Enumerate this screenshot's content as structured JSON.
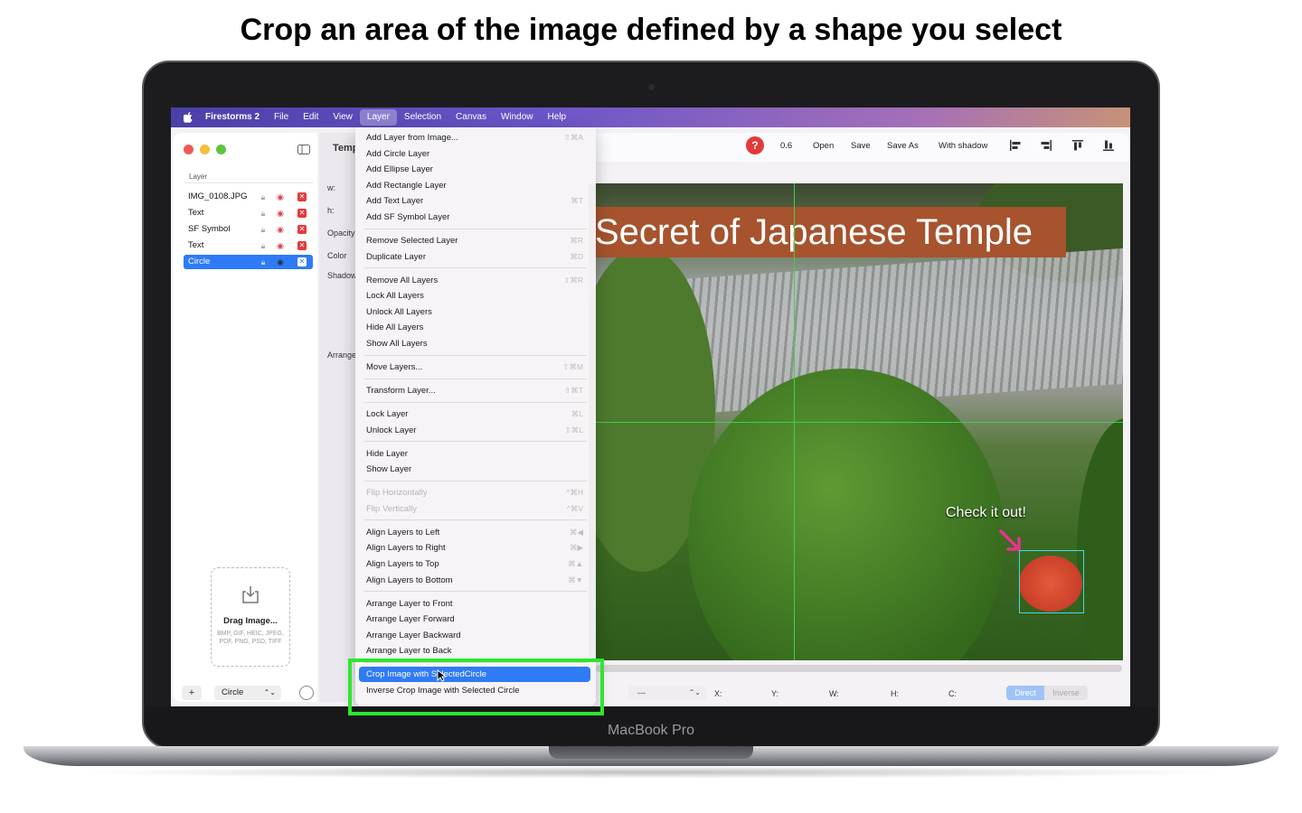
{
  "headline": "Crop an area of the image defined by a shape you select",
  "laptop": {
    "brand": "MacBook Pro"
  },
  "menubar": {
    "app": "Firestorms 2",
    "items": [
      "File",
      "Edit",
      "View",
      "Layer",
      "Selection",
      "Canvas",
      "Window",
      "Help"
    ],
    "active": "Layer"
  },
  "sidebar": {
    "section_label": "Layer",
    "layers": [
      "IMG_0108.JPG",
      "Text",
      "SF Symbol",
      "Text",
      "Circle"
    ],
    "selected_layer": "Circle",
    "dropzone": {
      "title": "Drag Image...",
      "formats": "BMP, GIF, HEIC, JPEG, PDF, PNG, PSD, TIFF"
    },
    "add_label": "+",
    "shape_select": "Circle"
  },
  "inspector": {
    "title": "Temp",
    "labels": [
      "w:",
      "h:",
      "Opacity",
      "Color",
      "Shadow",
      "Arrange"
    ]
  },
  "toolbar": {
    "help": "?",
    "zoom": "0.6",
    "open": "Open",
    "save": "Save",
    "save_as": "Save As",
    "with_shadow": "With shadow",
    "align_icons": [
      "align-left-icon",
      "align-right-icon",
      "align-top-icon",
      "align-bottom-icon"
    ]
  },
  "canvas": {
    "banner": "Secret of Japanese Temple",
    "callout": "Check it out!"
  },
  "bottom_bar": {
    "combo": "---",
    "labels": [
      "X:",
      "Y:",
      "W:",
      "H:",
      "C:"
    ],
    "segment": [
      "Direct",
      "Inverse"
    ],
    "segment_selected": "Direct"
  },
  "layer_menu": {
    "groups": [
      [
        {
          "label": "Add Layer from Image...",
          "shortcut": "⇧⌘A"
        },
        {
          "label": "Add Circle Layer",
          "shortcut": ""
        },
        {
          "label": "Add Ellipse Layer",
          "shortcut": ""
        },
        {
          "label": "Add Rectangle Layer",
          "shortcut": ""
        },
        {
          "label": "Add Text Layer",
          "shortcut": "⌘T"
        },
        {
          "label": "Add SF Symbol Layer",
          "shortcut": ""
        }
      ],
      [
        {
          "label": "Remove Selected Layer",
          "shortcut": "⌘R"
        },
        {
          "label": "Duplicate Layer",
          "shortcut": "⌘D"
        }
      ],
      [
        {
          "label": "Remove All Layers",
          "shortcut": "⇧⌘R"
        },
        {
          "label": "Lock All Layers",
          "shortcut": ""
        },
        {
          "label": "Unlock All Layers",
          "shortcut": ""
        },
        {
          "label": "Hide All Layers",
          "shortcut": ""
        },
        {
          "label": "Show All Layers",
          "shortcut": ""
        }
      ],
      [
        {
          "label": "Move Layers...",
          "shortcut": "⇧⌘M"
        }
      ],
      [
        {
          "label": "Transform Layer...",
          "shortcut": "⇧⌘T"
        }
      ],
      [
        {
          "label": "Lock Layer",
          "shortcut": "⌘L"
        },
        {
          "label": "Unlock Layer",
          "shortcut": "⇧⌘L"
        }
      ],
      [
        {
          "label": "Hide Layer",
          "shortcut": ""
        },
        {
          "label": "Show Layer",
          "shortcut": ""
        }
      ],
      [
        {
          "label": "Flip Horizontally",
          "shortcut": "^⌘H",
          "disabled": true
        },
        {
          "label": "Flip Vertically",
          "shortcut": "^⌘V",
          "disabled": true
        }
      ],
      [
        {
          "label": "Align Layers to Left",
          "shortcut": "⌘◀"
        },
        {
          "label": "Align Layers to Right",
          "shortcut": "⌘▶"
        },
        {
          "label": "Align Layers to Top",
          "shortcut": "⌘▲"
        },
        {
          "label": "Align Layers to Bottom",
          "shortcut": "⌘▼"
        }
      ],
      [
        {
          "label": "Arrange Layer to Front",
          "shortcut": ""
        },
        {
          "label": "Arrange Layer Forward",
          "shortcut": ""
        },
        {
          "label": "Arrange Layer Backward",
          "shortcut": ""
        },
        {
          "label": "Arrange Layer to Back",
          "shortcut": ""
        }
      ],
      [
        {
          "label": "Crop Image with SelectedCircle",
          "shortcut": "",
          "highlighted": true
        },
        {
          "label": "Inverse Crop Image with Selected Circle",
          "shortcut": ""
        }
      ]
    ]
  },
  "colors": {
    "accent": "#2f7bf5",
    "highlight_frame": "#2ee62e",
    "banner": "#a6532e",
    "guide": "#39d34a",
    "danger": "#e23a3a"
  }
}
